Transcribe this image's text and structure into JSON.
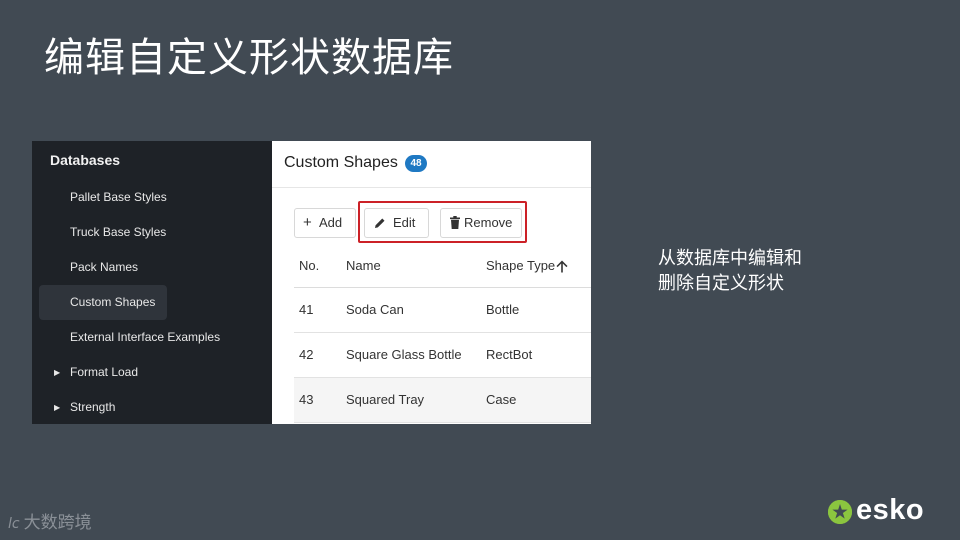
{
  "slide": {
    "title": "编辑自定义形状数据库",
    "note": "从数据库中编辑和删除自定义形状",
    "watermark": "大数跨境",
    "watermark_logo": "lc",
    "brand": "esko",
    "brand_color": "#8bc53f",
    "highlight_color": "#cc2127"
  },
  "sidebar": {
    "header": "Databases",
    "items": [
      {
        "label": "Pallet Base Styles",
        "expandable": false,
        "active": false
      },
      {
        "label": "Truck Base Styles",
        "expandable": false,
        "active": false
      },
      {
        "label": "Pack Names",
        "expandable": false,
        "active": false
      },
      {
        "label": "Custom Shapes",
        "expandable": false,
        "active": true
      },
      {
        "label": "External Interface Examples",
        "expandable": false,
        "active": false
      },
      {
        "label": "Format Load",
        "expandable": true,
        "active": false
      },
      {
        "label": "Strength",
        "expandable": true,
        "active": false
      }
    ]
  },
  "main": {
    "title": "Custom Shapes",
    "count": "48",
    "badge_color": "#1f79c3",
    "toolbar": {
      "add_label": "Add",
      "edit_label": "Edit",
      "remove_label": "Remove",
      "add_icon": "plus-icon",
      "edit_icon": "pencil-icon",
      "remove_icon": "trash-icon"
    },
    "table": {
      "columns": [
        "No.",
        "Name",
        "Shape Type"
      ],
      "sort_icon": "arrow-up-icon",
      "rows": [
        {
          "no": "41",
          "name": "Soda Can",
          "type": "Bottle"
        },
        {
          "no": "42",
          "name": "Square Glass Bottle",
          "type": "RectBot"
        },
        {
          "no": "43",
          "name": "Squared Tray",
          "type": "Case"
        }
      ]
    }
  }
}
